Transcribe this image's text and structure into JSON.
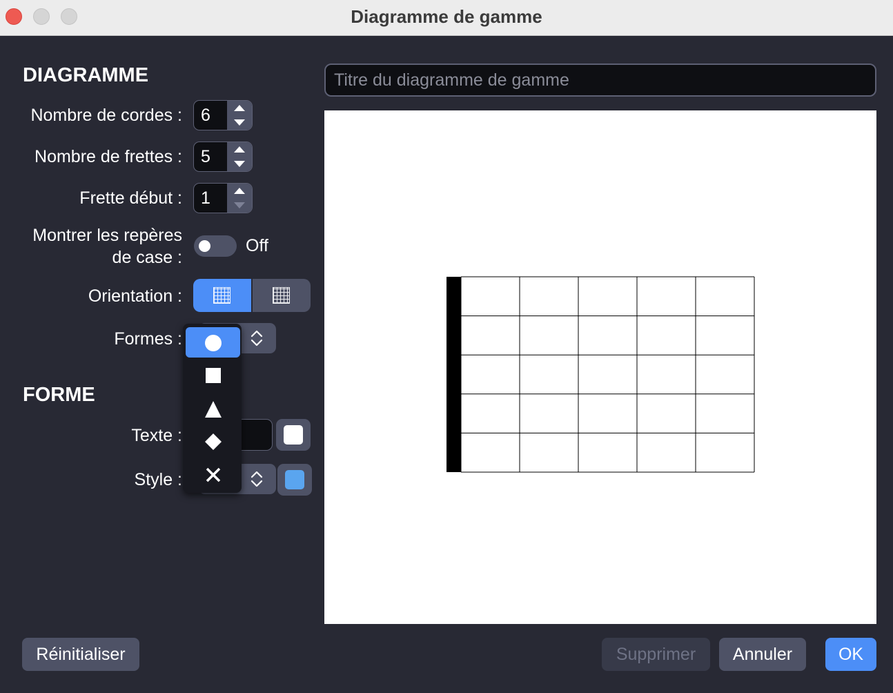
{
  "window": {
    "title": "Diagramme de gamme"
  },
  "diagram_section": {
    "heading": "DIAGRAMME",
    "strings_label": "Nombre de cordes :",
    "strings_value": "6",
    "frets_label": "Nombre de frettes :",
    "frets_value": "5",
    "start_fret_label": "Frette début :",
    "start_fret_value": "1",
    "markers_label_line1": "Montrer les repères",
    "markers_label_line2": "de case :",
    "markers_state": "Off",
    "orientation_label": "Orientation :",
    "shapes_label": "Formes :"
  },
  "shape_menu": {
    "items": [
      "circle-icon",
      "square-icon",
      "triangle-icon",
      "diamond-icon",
      "cross-icon"
    ],
    "selected_index": 0
  },
  "shape_section": {
    "heading": "FORME",
    "text_label": "Texte :",
    "style_label": "Style :",
    "text_color": "#ffffff",
    "style_color": "#5aa5ef"
  },
  "preview": {
    "title_placeholder": "Titre du diagramme de gamme",
    "strings": 6,
    "frets": 5
  },
  "buttons": {
    "reset": "Réinitialiser",
    "delete": "Supprimer",
    "cancel": "Annuler",
    "ok": "OK"
  },
  "colors": {
    "accent": "#4c8ef7",
    "background": "#282934"
  }
}
